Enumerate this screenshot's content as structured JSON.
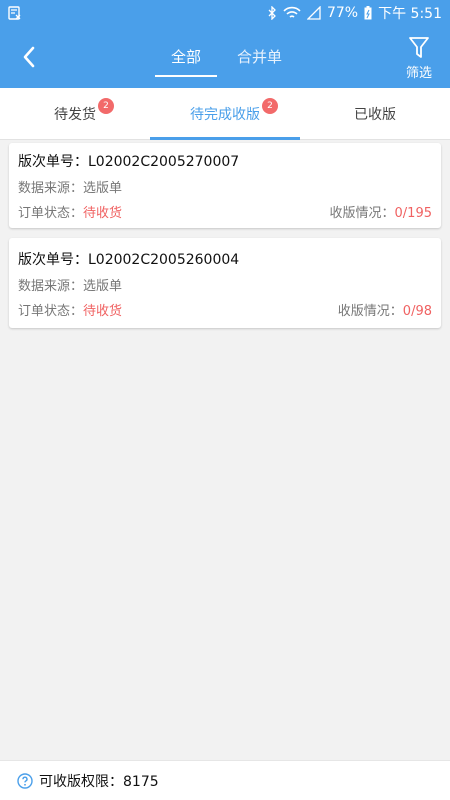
{
  "status_bar": {
    "battery": "77%",
    "time": "下午 5:51"
  },
  "header": {
    "tabs": [
      {
        "label": "全部",
        "active": true
      },
      {
        "label": "合并单",
        "active": false
      }
    ],
    "filter_label": "筛选"
  },
  "subtabs": [
    {
      "label": "待发货",
      "badge": "2",
      "active": false
    },
    {
      "label": "待完成收版",
      "badge": "2",
      "active": true
    },
    {
      "label": "已收版",
      "badge": "",
      "active": false
    }
  ],
  "orders": [
    {
      "title_label": "版次单号：",
      "order_no": "L02002C2005270007",
      "source_label": "数据来源：",
      "source": "选版单",
      "status_label": "订单状态：",
      "status": "待收货",
      "progress_label": "收版情况：",
      "progress": "0/195"
    },
    {
      "title_label": "版次单号：",
      "order_no": "L02002C2005260004",
      "source_label": "数据来源：",
      "source": "选版单",
      "status_label": "订单状态：",
      "status": "待收货",
      "progress_label": "收版情况：",
      "progress": "0/98"
    }
  ],
  "footer": {
    "label": "可收版权限：",
    "value": "8175"
  },
  "colors": {
    "primary": "#4a9fea",
    "accent_red": "#f06262",
    "badge": "#f26a6a",
    "background": "#f2f2f2"
  }
}
